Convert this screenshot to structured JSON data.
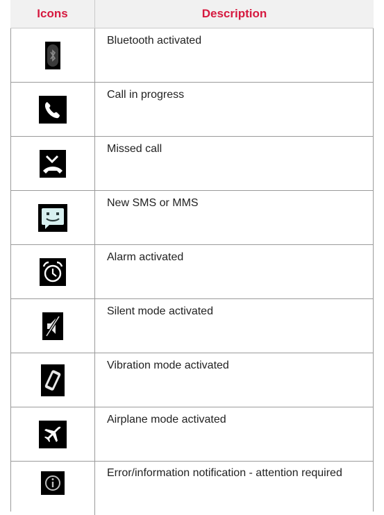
{
  "header": {
    "col_icons": "Icons",
    "col_description": "Description"
  },
  "rows": [
    {
      "icon": "bluetooth-icon",
      "description": "Bluetooth activated"
    },
    {
      "icon": "call-in-progress-icon",
      "description": "Call in progress"
    },
    {
      "icon": "missed-call-icon",
      "description": "Missed call"
    },
    {
      "icon": "sms-mms-icon",
      "description": "New SMS or MMS"
    },
    {
      "icon": "alarm-icon",
      "description": "Alarm activated"
    },
    {
      "icon": "silent-mode-icon",
      "description": "Silent mode activated"
    },
    {
      "icon": "vibration-mode-icon",
      "description": "Vibration mode activated"
    },
    {
      "icon": "airplane-mode-icon",
      "description": "Airplane mode activated"
    },
    {
      "icon": "info-icon",
      "description": "Error/information notification - attention required"
    }
  ],
  "colors": {
    "header_text": "#d6193f",
    "header_bg": "#f1f1f1",
    "icon_bg": "#000000"
  }
}
